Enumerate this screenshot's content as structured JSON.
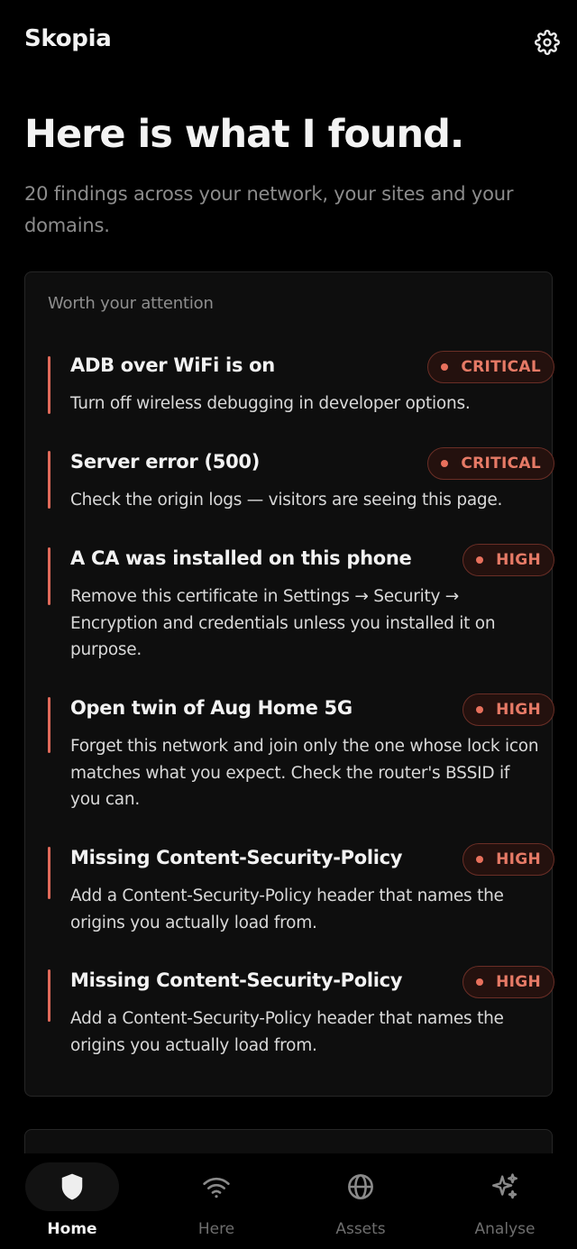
{
  "app": {
    "title": "Skopia"
  },
  "header": {
    "settings_icon": "gear-icon"
  },
  "hero": {
    "title": "Here is what I found.",
    "subtitle": "20 findings across your network, your sites and your domains."
  },
  "attention": {
    "title": "Worth your attention",
    "findings": [
      {
        "title": "ADB over WiFi is on",
        "severity": "CRITICAL",
        "description": "Turn off wireless debugging in developer options."
      },
      {
        "title": "Server error (500)",
        "severity": "CRITICAL",
        "description": "Check the origin logs — visitors are seeing this page."
      },
      {
        "title": "A CA was installed on this phone",
        "severity": "HIGH",
        "description": "Remove this certificate in Settings → Security → Encryption and credentials unless you installed it on purpose."
      },
      {
        "title": "Open twin of Aug Home 5G",
        "severity": "HIGH",
        "description": "Forget this network and join only the one whose lock icon matches what you expect. Check the router's BSSID if you can."
      },
      {
        "title": "Missing Content-Security-Policy",
        "severity": "HIGH",
        "description": "Add a Content-Security-Policy header that names the origins you actually load from."
      },
      {
        "title": "Missing Content-Security-Policy",
        "severity": "HIGH",
        "description": "Add a Content-Security-Policy header that names the origins you actually load from."
      }
    ]
  },
  "nav": {
    "items": [
      {
        "label": "Home",
        "icon": "shield-icon",
        "active": true
      },
      {
        "label": "Here",
        "icon": "wifi-icon",
        "active": false
      },
      {
        "label": "Assets",
        "icon": "globe-icon",
        "active": false
      },
      {
        "label": "Analyse",
        "icon": "sparkles-icon",
        "active": false
      }
    ]
  },
  "colors": {
    "background": "#000000",
    "card": "#0E0E0E",
    "accent": "#E06A5A",
    "badge_text": "#E67A66"
  }
}
